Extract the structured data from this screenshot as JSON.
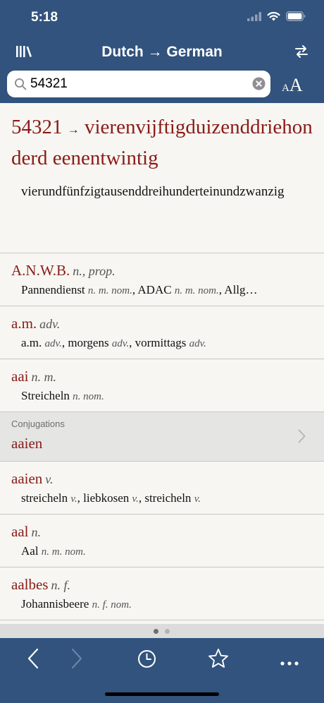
{
  "status": {
    "time": "5:18"
  },
  "nav": {
    "title": "Dutch → German"
  },
  "search": {
    "value": "54321"
  },
  "fontsize": {
    "small": "A",
    "big": "A"
  },
  "top_entry": {
    "headword": "54321",
    "arrow": "→",
    "headword_cont": "vierenvijftigduizenddriehonderd eenentwintig",
    "translation": "vierundfünfzigtausenddreihunderteinundzwanzig"
  },
  "entries": [
    {
      "headword": "A.N.W.B.",
      "gram": "n., prop.",
      "translation": [
        {
          "t": "Pannendienst",
          "g": "n. m. nom."
        },
        {
          "t": "ADAC",
          "g": "n. m. nom."
        },
        {
          "t": "Allg…",
          "g": ""
        }
      ]
    },
    {
      "headword": "a.m.",
      "gram": "adv.",
      "translation": [
        {
          "t": "a.m.",
          "g": "adv."
        },
        {
          "t": "morgens",
          "g": "adv."
        },
        {
          "t": "vormittags",
          "g": "adv."
        }
      ]
    },
    {
      "headword": "aai",
      "gram": "n. m.",
      "translation": [
        {
          "t": "Streicheln",
          "g": "n. nom."
        }
      ]
    }
  ],
  "conjugations": {
    "label": "Conjugations",
    "word": "aaien"
  },
  "entries2": [
    {
      "headword": "aaien",
      "gram": "v.",
      "translation": [
        {
          "t": "streicheln",
          "g": "v."
        },
        {
          "t": "liebkosen",
          "g": "v."
        },
        {
          "t": "streicheln",
          "g": "v."
        }
      ]
    },
    {
      "headword": "aal",
      "gram": "n.",
      "translation": [
        {
          "t": "Aal",
          "g": "n. m. nom."
        }
      ]
    },
    {
      "headword": "aalbes",
      "gram": "n. f.",
      "translation": [
        {
          "t": "Johannisbeere",
          "g": "n. f. nom."
        }
      ]
    }
  ],
  "pager": {
    "active_page": 1,
    "page_count": 2
  },
  "colors": {
    "bar": "#31537d",
    "headword": "#8a1b17",
    "content_bg": "#f7f6f2"
  },
  "icons": [
    "library-icon",
    "swap-icon",
    "search-icon",
    "clear-icon",
    "back-icon",
    "forward-icon",
    "history-icon",
    "star-icon",
    "more-icon"
  ]
}
